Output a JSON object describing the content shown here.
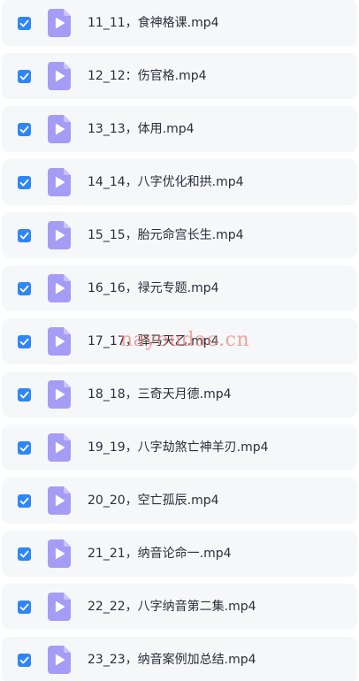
{
  "colors": {
    "row_background": "#f6f7f9",
    "checkbox": "#2f86f6",
    "file_icon": "#a59cf5",
    "file_icon_fold": "#c9c3fa",
    "text": "#2a2f3a",
    "watermark": "#e8786e"
  },
  "icons": {
    "checkbox": "check-icon",
    "file": "video-file-icon"
  },
  "files": [
    {
      "name": "11_11，食神格课.mp4",
      "checked": true
    },
    {
      "name": "12_12：伤官格.mp4",
      "checked": true
    },
    {
      "name": "13_13，体用.mp4",
      "checked": true
    },
    {
      "name": "14_14，八字优化和拱.mp4",
      "checked": true
    },
    {
      "name": "15_15，胎元命宫长生.mp4",
      "checked": true
    },
    {
      "name": "16_16，禄元专题.mp4",
      "checked": true
    },
    {
      "name": "17_17，驿马天乙.mp4",
      "checked": true
    },
    {
      "name": "18_18，三奇天月德.mp4",
      "checked": true
    },
    {
      "name": "19_19，八字劫煞亡神羊刃.mp4",
      "checked": true
    },
    {
      "name": "20_20，空亡孤辰.mp4",
      "checked": true
    },
    {
      "name": "21_21，纳音论命一.mp4",
      "checked": true
    },
    {
      "name": "22_22，八字纳音第二集.mp4",
      "checked": true
    },
    {
      "name": "23_23，纳音案例加总结.mp4",
      "checked": true
    }
  ],
  "watermark": "nayoudao.cn"
}
